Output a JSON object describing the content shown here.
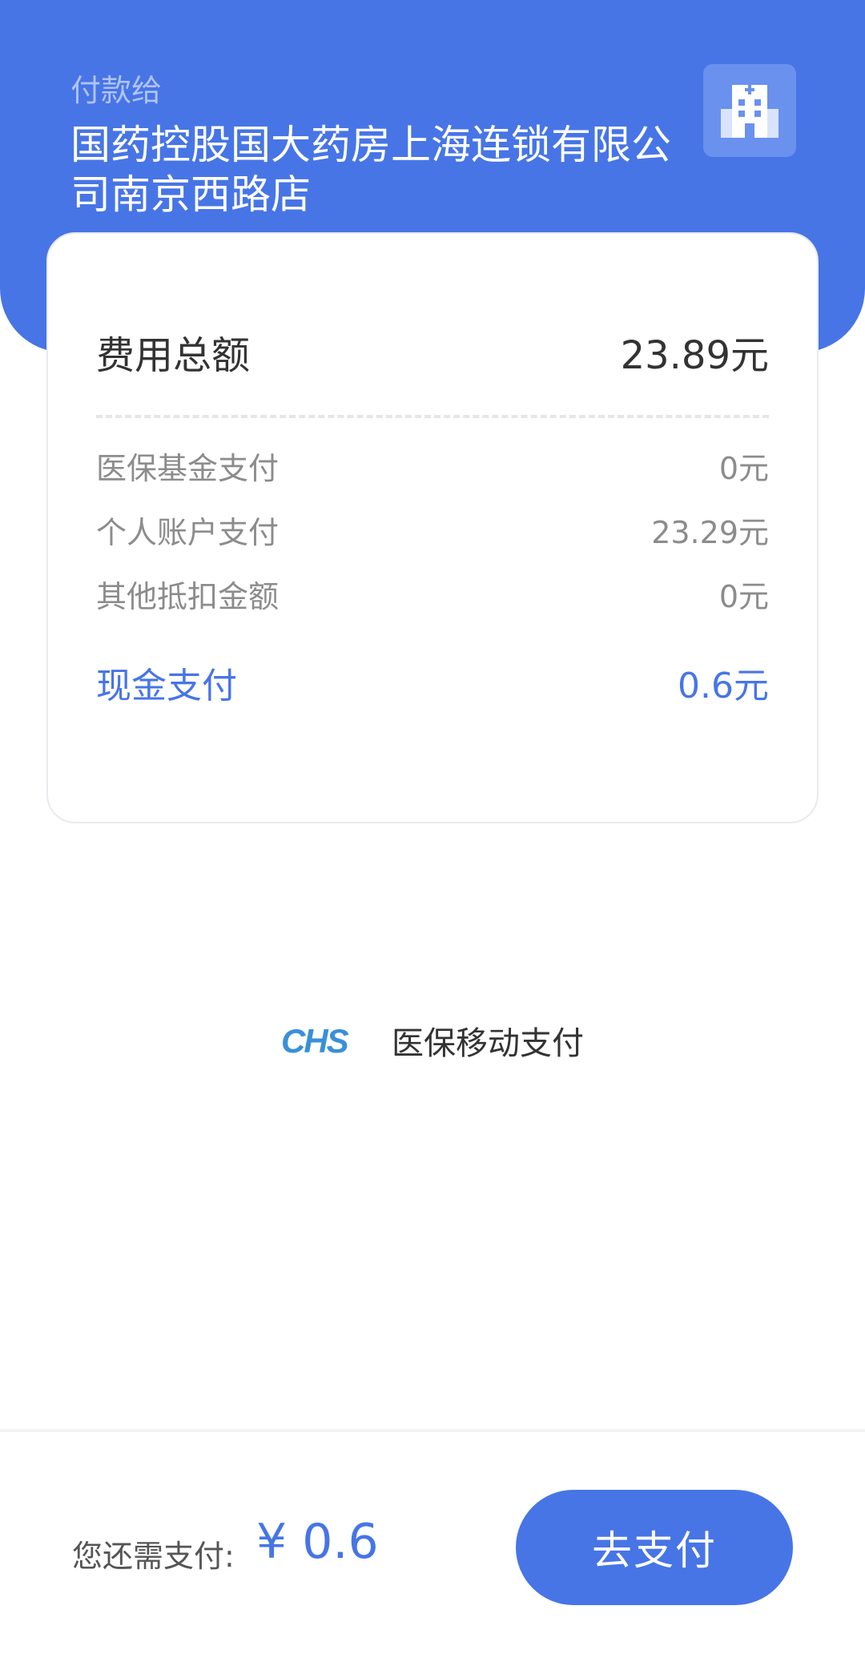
{
  "header": {
    "pay_to_label": "付款给",
    "merchant_name": "国药控股国大药房上海连锁有限公司南京西路店",
    "merchant_icon": "hospital-icon"
  },
  "summary": {
    "total_label": "费用总额",
    "total_value": "23.89元",
    "items": [
      {
        "label": "医保基金支付",
        "value": "0元"
      },
      {
        "label": "个人账户支付",
        "value": "23.29元"
      },
      {
        "label": "其他抵扣金额",
        "value": "0元"
      }
    ],
    "cash_label": "现金支付",
    "cash_value": "0.6元"
  },
  "brand": {
    "logo_text": "CHS",
    "caption": "医保移动支付"
  },
  "footer": {
    "remain_label": "您还需支付:",
    "remain_amount": "¥ 0.6",
    "pay_button": "去支付"
  },
  "colors": {
    "primary": "#4775E6",
    "logo_blue": "#3A8FD9"
  }
}
